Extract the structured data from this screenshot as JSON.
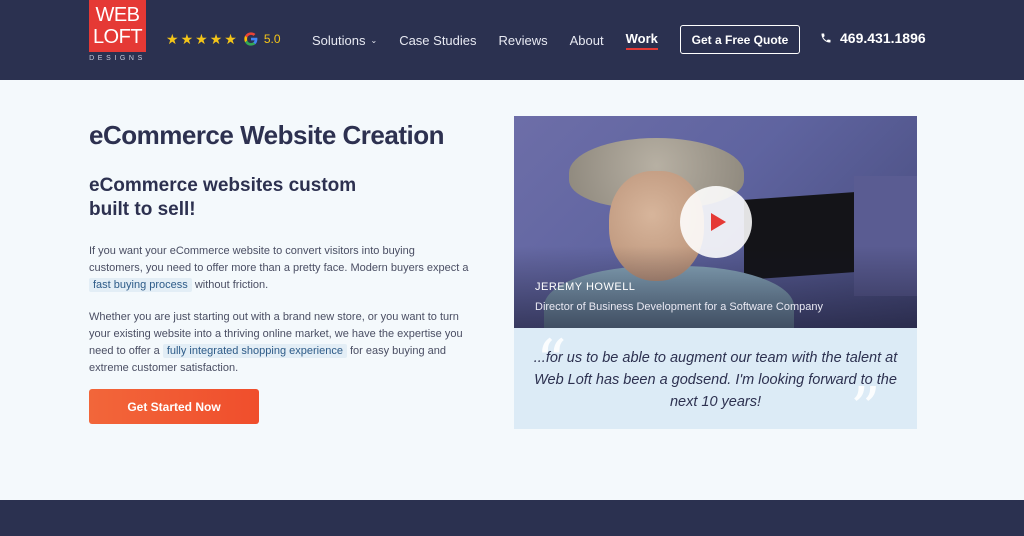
{
  "logo": {
    "line1": "WEB",
    "line2": "LOFT",
    "sub": "DESIGNS"
  },
  "rating": {
    "stars": 5,
    "value": "5.0",
    "icon": "google-icon"
  },
  "nav": {
    "items": [
      {
        "label": "Solutions",
        "has_dropdown": true
      },
      {
        "label": "Case Studies"
      },
      {
        "label": "Reviews"
      },
      {
        "label": "About"
      },
      {
        "label": "Work",
        "active": true
      }
    ],
    "quote_button": "Get a Free Quote",
    "phone": "469.431.1896"
  },
  "main": {
    "title": "eCommerce Website Creation",
    "subtitle": "eCommerce websites custom built to sell!",
    "para1": {
      "before": "If you want your eCommerce website to convert visitors into buying customers, you need to offer more than a pretty face. Modern buyers expect a ",
      "highlight": "fast buying process",
      "after": " without friction."
    },
    "para2": {
      "before": "Whether you are just starting out with a brand new store, or you want to turn your existing website into a thriving online market, we have the expertise you need to offer a ",
      "highlight": "fully integrated shopping experience",
      "after": " for easy buying and extreme customer satisfaction."
    },
    "cta": "Get Started Now"
  },
  "testimonial": {
    "name": "JEREMY HOWELL",
    "role": "Director of Business Development for a Software Company",
    "quote": "...for us to be able to augment our team with the talent at Web Loft has been a godsend. I'm looking forward to the next 10 years!"
  },
  "colors": {
    "brand_navy": "#2b3150",
    "accent_red": "#e53935",
    "cta_orange": "#f2663a",
    "star_yellow": "#f4c518"
  }
}
